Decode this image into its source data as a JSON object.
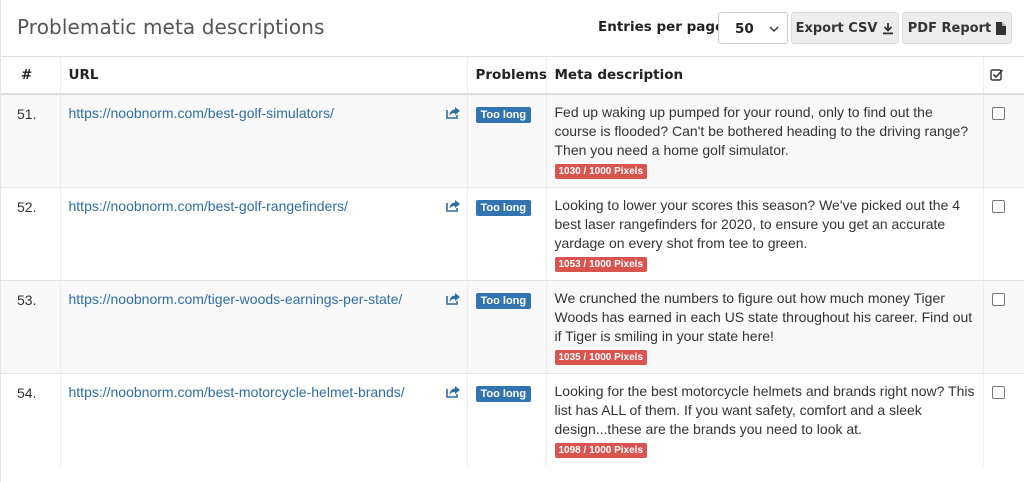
{
  "header": {
    "title": "Problematic meta descriptions",
    "entries_label": "Entries per page:",
    "entries_value": "50",
    "export_csv_label": "Export CSV",
    "pdf_report_label": "PDF Report"
  },
  "table": {
    "columns": {
      "num": "#",
      "url": "URL",
      "problems": "Problems",
      "meta": "Meta description"
    },
    "rows": [
      {
        "num": "51.",
        "url": "https://noobnorm.com/best-golf-simulators/",
        "problem": "Too long",
        "description": "Fed up waking up pumped for your round, only to find out the course is flooded? Can't be bothered heading to the driving range? Then you need a home golf simulator.",
        "pixels": "1030 / 1000 Pixels"
      },
      {
        "num": "52.",
        "url": "https://noobnorm.com/best-golf-rangefinders/",
        "problem": "Too long",
        "description": "Looking to lower your scores this season? We've picked out the 4 best laser rangefinders for 2020, to ensure you get an accurate yardage on every shot from tee to green.",
        "pixels": "1053 / 1000 Pixels"
      },
      {
        "num": "53.",
        "url": "https://noobnorm.com/tiger-woods-earnings-per-state/",
        "problem": "Too long",
        "description": "We crunched the numbers to figure out how much money Tiger Woods has earned in each US state throughout his career. Find out if Tiger is smiling in your state here!",
        "pixels": "1035 / 1000 Pixels"
      },
      {
        "num": "54.",
        "url": "https://noobnorm.com/best-motorcycle-helmet-brands/",
        "problem": "Too long",
        "description": "Looking for the best motorcycle helmets and brands right now? This list has ALL of them. If you want safety, comfort and a sleek design...these are the brands you need to look at.",
        "pixels": "1098 / 1000 Pixels"
      }
    ]
  },
  "colors": {
    "link": "#2d6ea5",
    "badge_problem": "#3174b0",
    "badge_pixels": "#d9534f",
    "row_stripe": "#f9f9f9"
  },
  "icons": {
    "csv": "download-icon",
    "pdf": "file-icon",
    "external": "share-icon",
    "select_all": "check-square-icon",
    "dropdown": "chevron-down-icon"
  }
}
